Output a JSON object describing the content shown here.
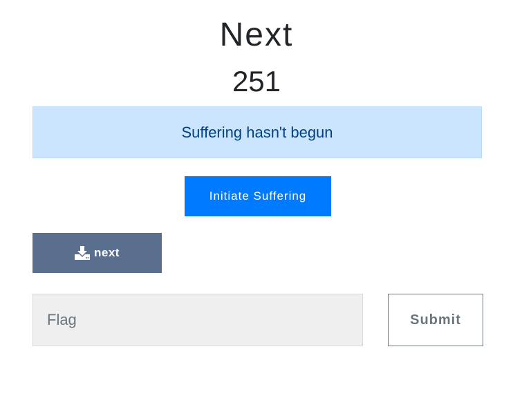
{
  "challenge": {
    "title": "Next",
    "value": "251"
  },
  "status": {
    "message": "Suffering hasn't begun",
    "bg_color": "#cce5ff",
    "text_color": "#004085"
  },
  "actions": {
    "initiate_label": "Initiate Suffering",
    "initiate_color": "#007bff",
    "download_label": "next",
    "download_icon": "download-icon",
    "download_color": "#5a6f8e"
  },
  "flag_form": {
    "placeholder": "Flag",
    "value": "",
    "submit_label": "Submit"
  }
}
